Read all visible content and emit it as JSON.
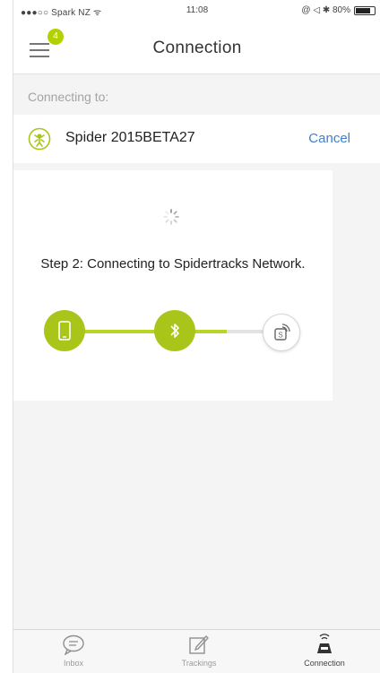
{
  "status_bar": {
    "carrier": "●●●○○ Spark NZ ᯤ",
    "time": "11:08",
    "battery_text": "@ ◁ ✱ 80%"
  },
  "nav": {
    "title": "Connection",
    "menu_badge": "4"
  },
  "connecting": {
    "label": "Connecting to:",
    "device_name": "Spider 2015BETA27",
    "cancel_label": "Cancel"
  },
  "progress": {
    "step_text": "Step 2: Connecting to Spidertracks Network."
  },
  "tabs": [
    {
      "label": "Inbox",
      "icon": "chat-icon"
    },
    {
      "label": "Trackings",
      "icon": "edit-icon"
    },
    {
      "label": "Connection",
      "icon": "spider-device-icon"
    }
  ],
  "colors": {
    "accent_green": "#aac51a",
    "link_blue": "#3f7fcf"
  }
}
